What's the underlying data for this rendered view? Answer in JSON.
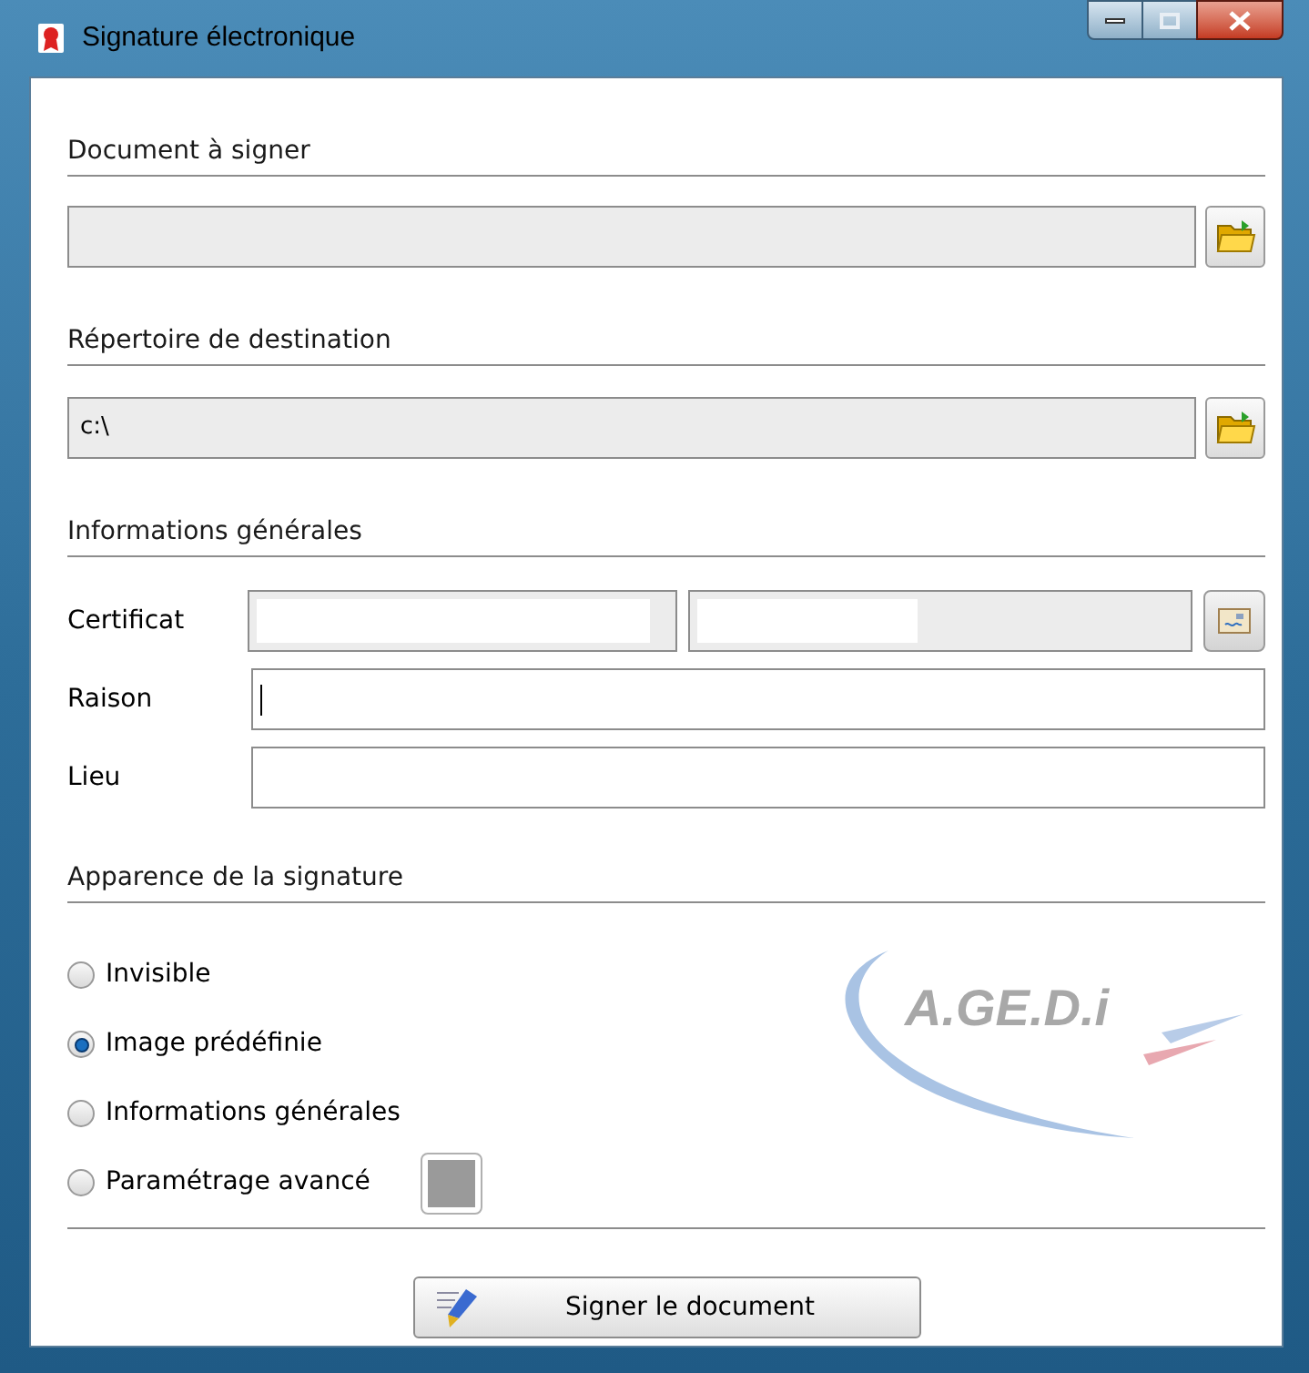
{
  "window": {
    "title": "Signature électronique"
  },
  "document": {
    "heading": "Document à signer"
  },
  "destination": {
    "heading": "Répertoire de destination",
    "value": "c:\\"
  },
  "general": {
    "heading": "Informations générales",
    "fields": [
      {
        "kind": "certificate",
        "label": "Certificat"
      },
      {
        "kind": "text",
        "label": "Raison",
        "focused": true
      },
      {
        "kind": "text",
        "label": "Lieu",
        "focused": false
      }
    ]
  },
  "appearance": {
    "heading": "Apparence de la signature",
    "logo": "A.GE.D.i",
    "options": [
      {
        "label": "Invisible",
        "selected": false
      },
      {
        "label": "Image prédéfinie",
        "selected": true
      },
      {
        "label": "Informations générales",
        "selected": false
      },
      {
        "label": "Paramétrage avancé",
        "selected": false,
        "has_picker": true
      }
    ]
  },
  "sign_button": {
    "label": "Signer le document"
  }
}
